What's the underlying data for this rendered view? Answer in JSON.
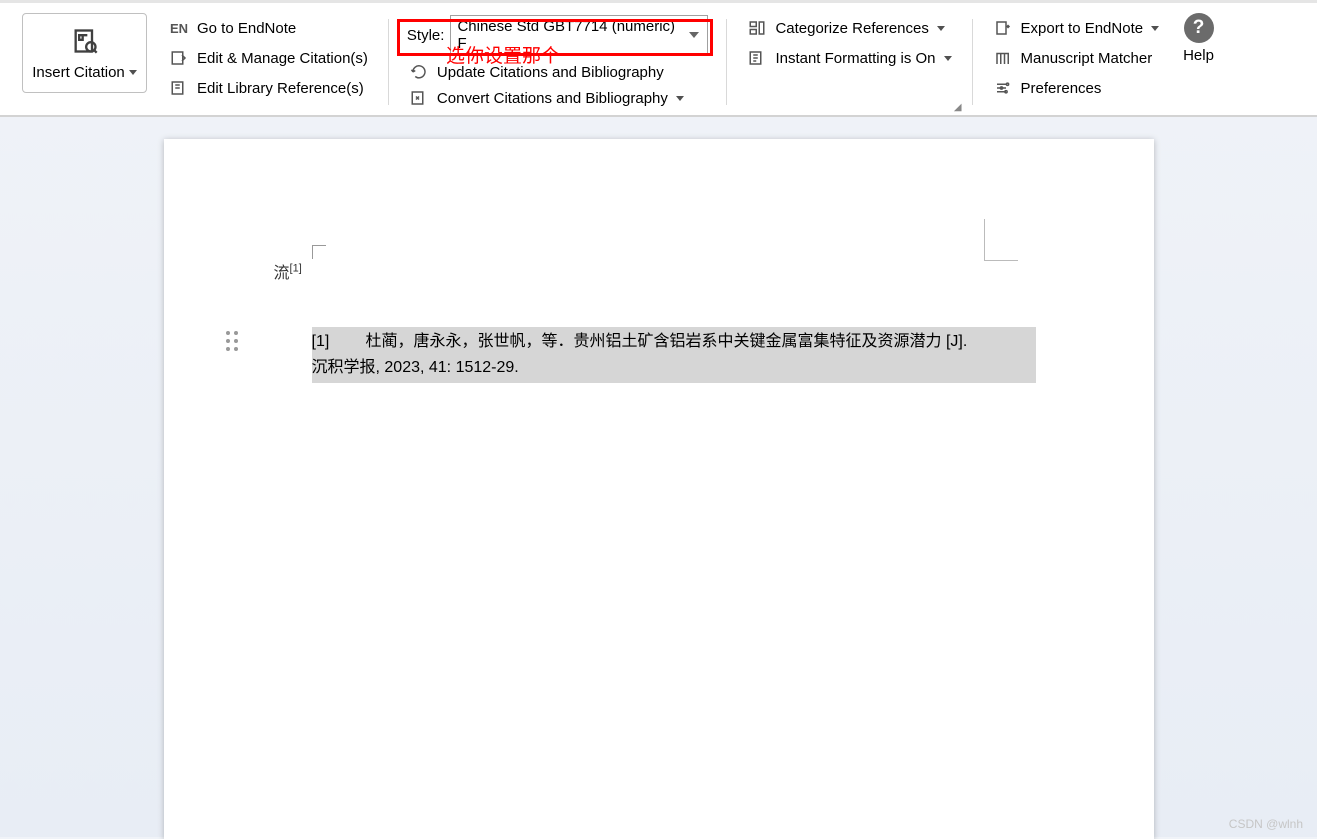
{
  "ribbon": {
    "insert_citation": "Insert Citation",
    "group2": {
      "go_to_endnote": "Go to EndNote",
      "edit_manage": "Edit & Manage Citation(s)",
      "edit_library": "Edit Library Reference(s)"
    },
    "group3": {
      "style_label": "Style:",
      "style_value": "Chinese Std GBT7714 (numeric) F",
      "update": "Update Citations and Bibliography",
      "convert": "Convert Citations and Bibliography"
    },
    "group4": {
      "categorize": "Categorize References",
      "instant": "Instant Formatting is On"
    },
    "group5": {
      "export": "Export to EndNote",
      "manuscript": "Manuscript Matcher",
      "preferences": "Preferences"
    },
    "help": "Help"
  },
  "annotation": {
    "red_note": "选你设置那个"
  },
  "document": {
    "line1_text": "流",
    "line1_sup": "[1]",
    "reference": {
      "num": "[1]",
      "text_line1": "杜蔺，唐永永，张世帆，等．贵州铝土矿含铝岩系中关键金属富集特征及资源潜力  [J].",
      "text_line2": "沉积学报, 2023, 41: 1512-29."
    }
  },
  "watermark": "CSDN @wlnh"
}
